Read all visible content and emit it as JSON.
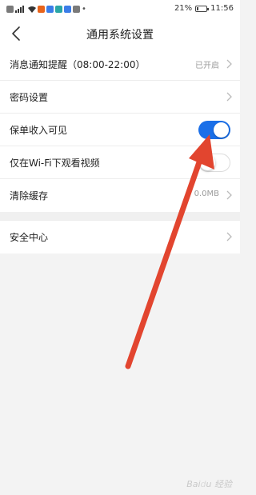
{
  "status_bar": {
    "battery": "21%",
    "battery_level": 0.21,
    "time": "11:56",
    "network_label": "46"
  },
  "header": {
    "title": "通用系统设置",
    "back_icon": "chevron-left-icon"
  },
  "settings": {
    "notification": {
      "label": "消息通知提醒（08:00-22:00）",
      "value": "已开启"
    },
    "password": {
      "label": "密码设置"
    },
    "policy_income": {
      "label": "保单收入可见",
      "enabled": true
    },
    "wifi_video": {
      "label": "仅在Wi-Fi下观看视频",
      "enabled": false
    },
    "clear_cache": {
      "label": "清除缓存",
      "value": "0.0MB"
    },
    "security": {
      "label": "安全中心"
    }
  },
  "colors": {
    "toggle_on": "#1a6fe8",
    "arrow": "#e2452f"
  },
  "watermark": "Baidu 经验"
}
